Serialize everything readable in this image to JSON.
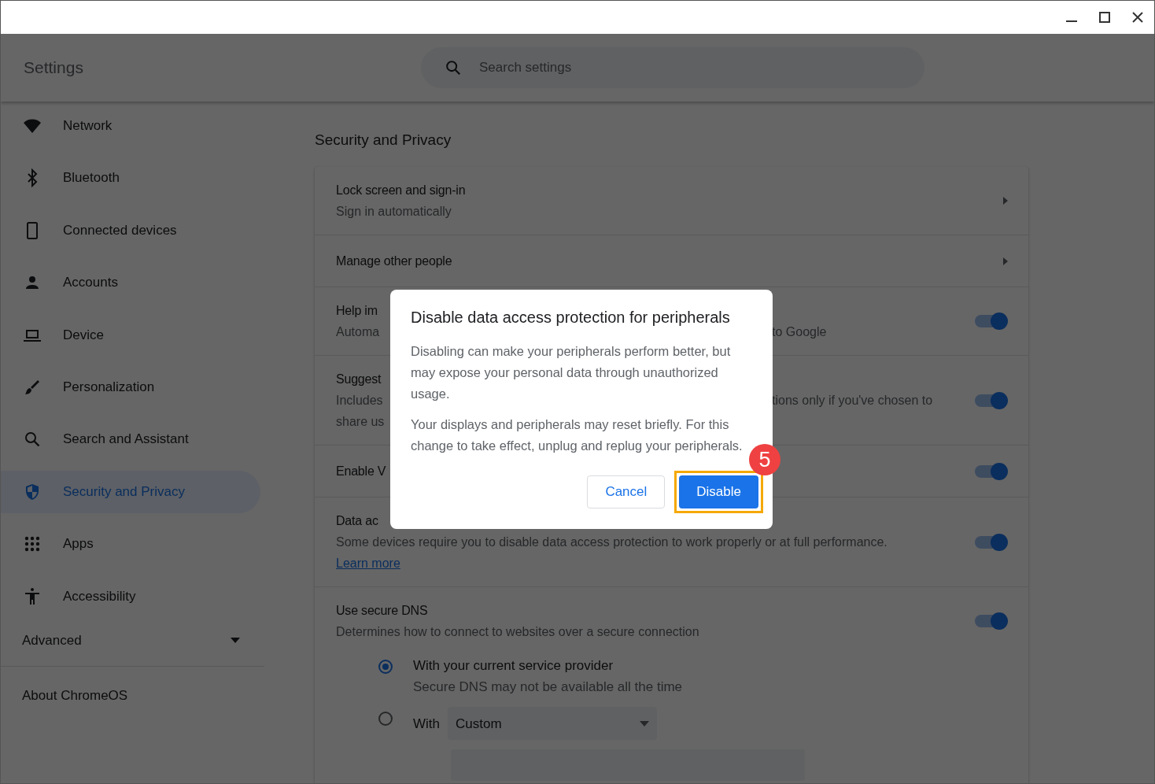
{
  "app": {
    "title": "Settings",
    "search": {
      "placeholder": "Search settings"
    }
  },
  "sidebar": {
    "items": [
      {
        "label": "Network",
        "selected": false
      },
      {
        "label": "Bluetooth",
        "selected": false
      },
      {
        "label": "Connected devices",
        "selected": false
      },
      {
        "label": "Accounts",
        "selected": false
      },
      {
        "label": "Device",
        "selected": false
      },
      {
        "label": "Personalization",
        "selected": false
      },
      {
        "label": "Search and Assistant",
        "selected": false
      },
      {
        "label": "Security and Privacy",
        "selected": true
      },
      {
        "label": "Apps",
        "selected": false
      },
      {
        "label": "Accessibility",
        "selected": false
      }
    ],
    "advanced": {
      "label": "Advanced",
      "expanded": false
    },
    "about": "About ChromeOS"
  },
  "page": {
    "heading": "Security and Privacy",
    "rows": [
      {
        "kind": "link",
        "title": "Lock screen and sign-in",
        "subtitle": [
          {
            "left": "Sign in automatically"
          }
        ]
      },
      {
        "kind": "link",
        "title": "Manage other people"
      },
      {
        "kind": "toggle",
        "on": true,
        "title": "Help im",
        "subtitle": [
          {
            "left": "Automa",
            "right": "to Google"
          }
        ]
      },
      {
        "kind": "toggle",
        "on": true,
        "title": "Suggest",
        "subtitle": [
          {
            "left": "Includes",
            "right": "tions only if you've chosen to"
          },
          {
            "left": "share us"
          }
        ]
      },
      {
        "kind": "toggle",
        "on": true,
        "title": "Enable V"
      },
      {
        "kind": "toggle",
        "on": true,
        "title": "Data ac",
        "subtitle": [
          {
            "left": "Some devices require you to disable data access protection to work properly or at full performance."
          }
        ],
        "link": "Learn more"
      },
      {
        "kind": "toggle",
        "on": true,
        "title": "Use secure DNS",
        "subtitle": [
          {
            "left": "Determines how to connect to websites over a secure connection"
          }
        ],
        "options": [
          {
            "label": "With your current service provider",
            "description": "Secure DNS may not be available all the time",
            "selected": true
          },
          {
            "label": "With",
            "dropdown": "Custom",
            "selected": false
          }
        ]
      }
    ]
  },
  "dialog": {
    "title": "Disable data access protection for peripherals",
    "paragraphs": [
      "Disabling can make your peripherals perform better, but may expose your personal data through unauthorized usage.",
      "Your displays and peripherals may reset briefly. For this change to take effect, unplug and replug your peripherals."
    ],
    "buttons": [
      {
        "label": "Cancel",
        "kind": "secondary",
        "highlighted": false
      },
      {
        "label": "Disable",
        "kind": "primary",
        "highlighted": true
      }
    ],
    "step_badge": "5"
  }
}
